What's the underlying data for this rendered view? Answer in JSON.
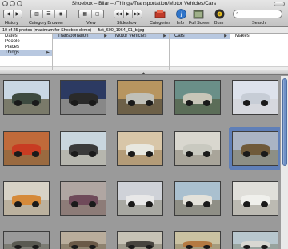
{
  "window": {
    "title": "Shoebox – Bilar – /Things/Transportation/Motor Vehicles/Cars"
  },
  "toolbar": {
    "history_label": "History",
    "category_browser_label": "Category Browser",
    "view_label": "View",
    "slideshow_label": "Slideshow",
    "categories_label": "Categories",
    "info_label": "Info",
    "fullscreen_label": "Full Screen",
    "burn_label": "Burn",
    "search_label": "Search",
    "info_icon_glyph": "i"
  },
  "status": {
    "text": "10 of 25 photos (maximum for Shoebox demo) — fiat_600_1964_01_b.jpg"
  },
  "browser": {
    "columns": [
      {
        "header": "",
        "items": [
          "Dates",
          "People",
          "Places",
          "Things"
        ],
        "selected": 3
      },
      {
        "header": "Transportation",
        "items": [],
        "selected": -1
      },
      {
        "header": "Motor Vehicles",
        "items": [],
        "selected": -1
      },
      {
        "header": "Cars",
        "items": [],
        "selected": -1
      },
      {
        "header": "Makes",
        "items": [],
        "selected": -1
      }
    ]
  },
  "colors": {
    "selection": "#5f7fb8",
    "accent_blue": "#2f74c9"
  },
  "thumbnails": [
    {
      "sky": "#c9d7e4",
      "ground": "#7a7a6a",
      "car": "#3d4a3f"
    },
    {
      "sky": "#2c3a62",
      "ground": "#888",
      "car": "#2a2a2a"
    },
    {
      "sky": "#b79560",
      "ground": "#6d6048",
      "car": "#c0c0b8"
    },
    {
      "sky": "#6a8f88",
      "ground": "#5b6d58",
      "car": "#c8c6b8"
    },
    {
      "sky": "#dde2ec",
      "ground": "#d6d8de",
      "car": "#c7cdd6"
    },
    {
      "sky": "#c06a3a",
      "ground": "#9a6a40",
      "car": "#c83c22"
    },
    {
      "sky": "#c9d6de",
      "ground": "#b6b6ae",
      "car": "#3a3a3a"
    },
    {
      "sky": "#d8c6a8",
      "ground": "#b49c78",
      "car": "#e8e8e0"
    },
    {
      "sky": "#d9d7cf",
      "ground": "#a9a59a",
      "car": "#c9c9c0"
    },
    {
      "sky": "#aab4c4",
      "ground": "#8d8f86",
      "car": "#6f5a3a"
    },
    {
      "sky": "#d7d2c6",
      "ground": "#bbb19e",
      "car": "#d58a3a"
    },
    {
      "sky": "#b0a6a2",
      "ground": "#8d7c78",
      "car": "#6f4a5a"
    },
    {
      "sky": "#cfd2d8",
      "ground": "#a8a8a2",
      "car": "#e8e8e8"
    },
    {
      "sky": "#aac0cf",
      "ground": "#8f8f86",
      "car": "#e4e2da"
    },
    {
      "sky": "#e0dfda",
      "ground": "#bcbab2",
      "car": "#f0f0ec"
    },
    {
      "sky": "#9a9a9a",
      "ground": "#7c7c74",
      "car": "#5a5a52"
    },
    {
      "sky": "#b9ad9c",
      "ground": "#8e826f",
      "car": "#6b5a48"
    },
    {
      "sky": "#c7c3b6",
      "ground": "#9e9a8c",
      "car": "#47443e"
    },
    {
      "sky": "#cac2a2",
      "ground": "#a69c7e",
      "car": "#b47a42"
    },
    {
      "sky": "#b8c7ce",
      "ground": "#98a39e",
      "car": "#d8d8d2"
    }
  ]
}
